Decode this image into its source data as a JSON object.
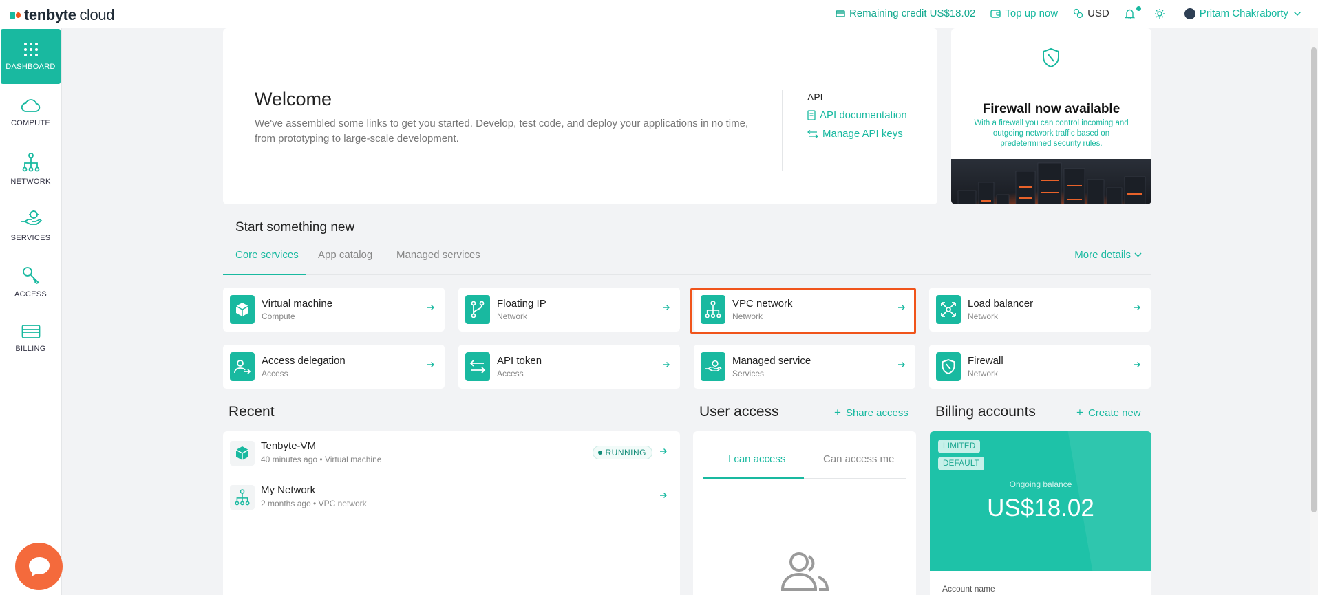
{
  "brand": {
    "name_bold": "tenbyte",
    "name_light": "cloud"
  },
  "topbar": {
    "credit_label": "Remaining credit US$18.02",
    "topup_label": "Top up now",
    "currency": "USD",
    "user_name": "Pritam Chakraborty"
  },
  "sidebar": {
    "items": [
      {
        "label": "DASHBOARD",
        "icon": "grid-icon",
        "active": true
      },
      {
        "label": "COMPUTE",
        "icon": "cloud-icon"
      },
      {
        "label": "NETWORK",
        "icon": "network-icon"
      },
      {
        "label": "SERVICES",
        "icon": "hand-service-icon"
      },
      {
        "label": "ACCESS",
        "icon": "key-icon"
      },
      {
        "label": "BILLING",
        "icon": "card-icon"
      }
    ]
  },
  "welcome": {
    "title": "Welcome",
    "description": "We've assembled some links to get you started. Develop, test code, and deploy your applications in no time, from prototyping to large-scale development.",
    "api_title": "API",
    "api_docs": "API documentation",
    "api_keys": "Manage API keys"
  },
  "promo": {
    "title": "Firewall now available",
    "description": "With a firewall you can control incoming and outgoing network traffic based on predetermined security rules."
  },
  "start": {
    "title": "Start something new",
    "tabs": [
      "Core services",
      "App catalog",
      "Managed services"
    ],
    "more_details": "More details",
    "tiles": [
      {
        "name": "Virtual machine",
        "sub": "Compute",
        "icon": "cube-icon"
      },
      {
        "name": "Floating IP",
        "sub": "Network",
        "icon": "branch-icon"
      },
      {
        "name": "VPC network",
        "sub": "Network",
        "icon": "network-icon"
      },
      {
        "name": "Load balancer",
        "sub": "Network",
        "icon": "expand-arrows-icon"
      },
      {
        "name": "Access delegation",
        "sub": "Access",
        "icon": "user-delegate-icon"
      },
      {
        "name": "API token",
        "sub": "Access",
        "icon": "swap-arrows-icon"
      },
      {
        "name": "Managed service",
        "sub": "Services",
        "icon": "hand-service-icon"
      },
      {
        "name": "Firewall",
        "sub": "Network",
        "icon": "shield-icon"
      }
    ]
  },
  "recent": {
    "title": "Recent",
    "items": [
      {
        "name": "Tenbyte-VM",
        "time": "40 minutes ago",
        "type": "Virtual machine",
        "status": "RUNNING"
      },
      {
        "name": "My Network",
        "time": "2 months ago",
        "type": "VPC network"
      }
    ]
  },
  "user_access": {
    "title": "User access",
    "share": "Share access",
    "tabs": [
      "I can access",
      "Can access me"
    ]
  },
  "billing": {
    "title": "Billing accounts",
    "create": "Create new",
    "badges": [
      "LIMITED",
      "DEFAULT"
    ],
    "ongoing_label": "Ongoing balance",
    "balance": "US$18.02",
    "account_name_label": "Account name"
  },
  "colors": {
    "accent": "#19b9a0",
    "highlight": "#f0541b",
    "chat": "#f46a3c"
  }
}
